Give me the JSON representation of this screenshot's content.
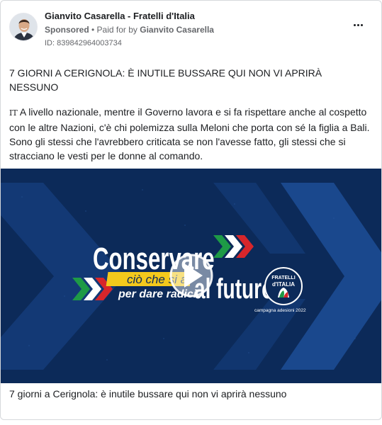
{
  "post": {
    "page_name": "Gianvito Casarella - Fratelli d'Italia",
    "sponsored_label": "Sponsored",
    "paid_for_label": "• Paid for by",
    "paid_for_name": "Gianvito Casarella",
    "ad_id": "ID: 839842964003734",
    "headline": "7 GIORNI A CERIGNOLA: È INUTILE BUSSARE QUI NON VI APRIRÀ NESSUNO",
    "language_tag": "IT",
    "body": "A livello nazionale, mentre il Governo lavora e si fa rispettare anche al cospetto con le altre Nazioni, c'è chi polemizza sulla Meloni che porta con sé la figlia a Bali. Sono gli stessi che l'avrebbero criticata se non l'avesse fatto, gli stessi che si stracciano le vesti per le donne al comando.",
    "ellipsis": "...",
    "caption": "7 giorni a Cerignola: è inutile bussare qui non vi aprirà nessuno"
  },
  "video": {
    "title_line1": "Conservare",
    "highlight_line1": "ciò che si ama",
    "highlight_line2": "per dare radici",
    "title_line2": "al futuro",
    "logo_line1": "FRATELLI",
    "logo_line2": "d'ITALIA",
    "campaign": "campagna adesioni 2022"
  },
  "colors": {
    "video_background": "#0c2a59",
    "chevron_blue": "#1d4e96",
    "flag_green": "#1e9a46",
    "flag_red": "#d7262b",
    "highlight_yellow": "#f3c91c",
    "text_primary": "#1c1e21",
    "text_secondary": "#65676b"
  },
  "icons": [
    "more-options-icon",
    "play-icon",
    "tricolor-chevron-icon",
    "flame-logo-icon"
  ]
}
